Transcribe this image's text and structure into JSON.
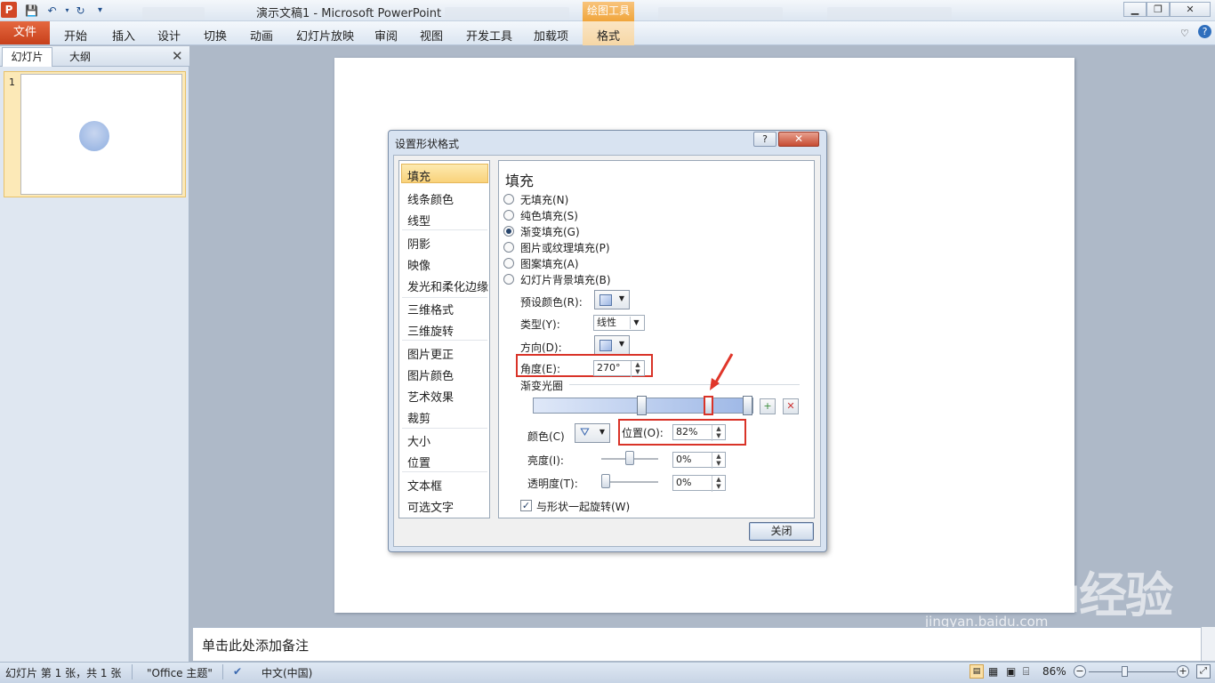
{
  "window": {
    "title": "演示文稿1  -  Microsoft PowerPoint",
    "contextual_group": "绘图工具",
    "logo": "P"
  },
  "ribbon": {
    "file_tab": "文件",
    "tabs": [
      "开始",
      "插入",
      "设计",
      "切换",
      "动画",
      "幻灯片放映",
      "审阅",
      "视图",
      "开发工具",
      "加载项",
      "格式"
    ]
  },
  "left_panel": {
    "tab_slides": "幻灯片",
    "tab_outline": "大纲",
    "thumb_number": "1",
    "close": "✕"
  },
  "dialog": {
    "title": "设置形状格式",
    "help": "?",
    "close_x": "✕",
    "nav_items": [
      "填充",
      "线条颜色",
      "线型",
      "阴影",
      "映像",
      "发光和柔化边缘",
      "三维格式",
      "三维旋转",
      "图片更正",
      "图片颜色",
      "艺术效果",
      "裁剪",
      "大小",
      "位置",
      "文本框",
      "可选文字"
    ],
    "section_title": "填充",
    "fill_options": [
      "无填充(N)",
      "纯色填充(S)",
      "渐变填充(G)",
      "图片或纹理填充(P)",
      "图案填充(A)",
      "幻灯片背景填充(B)"
    ],
    "selected_fill": "渐变填充(G)",
    "preset_label": "预设颜色(R):",
    "type_label": "类型(Y):",
    "type_value": "线性",
    "direction_label": "方向(D):",
    "angle_label": "角度(E):",
    "angle_value": "270°",
    "gradient_stops_label": "渐变光圈",
    "color_label": "颜色(C)",
    "position_label": "位置(O):",
    "position_value": "82%",
    "brightness_label": "亮度(I):",
    "brightness_value": "0%",
    "transparency_label": "透明度(T):",
    "transparency_value": "0%",
    "rotate_label": "与形状一起旋转(W)",
    "rotate_checked": true,
    "close_button": "关闭"
  },
  "notes": {
    "placeholder": "单击此处添加备注"
  },
  "status": {
    "slide_info": "幻灯片 第 1 张，共 1 张",
    "theme": "\"Office 主题\"",
    "language": "中文(中国)",
    "zoom": "86%"
  },
  "watermark": {
    "brand": "Baidu经验",
    "url": "jingyan.baidu.com"
  },
  "colors": {
    "file_tab": "#d24726",
    "contextual": "#f0a53b",
    "highlight_box": "#d93328",
    "selected_nav": "#f9d27a"
  }
}
